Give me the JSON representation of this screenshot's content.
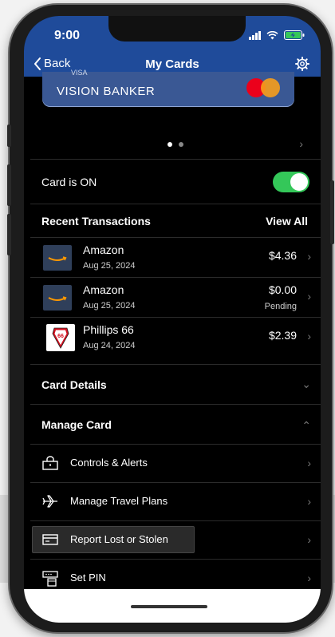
{
  "status_bar": {
    "time": "9:00"
  },
  "nav": {
    "back_label": "Back",
    "title": "My Cards"
  },
  "card": {
    "top_text": "VISA",
    "name": "VISION BANKER",
    "carousel_pages": 2,
    "carousel_active": 1
  },
  "card_status": {
    "label": "Card is ON",
    "enabled": true
  },
  "transactions": {
    "header": "Recent Transactions",
    "view_all": "View All",
    "items": [
      {
        "merchant": "Amazon",
        "date": "Aug 25, 2024",
        "amount": "$4.36",
        "status": "",
        "logo": "amazon-logo"
      },
      {
        "merchant": "Amazon",
        "date": "Aug 25, 2024",
        "amount": "$0.00",
        "status": "Pending",
        "logo": "amazon-logo"
      },
      {
        "merchant": "Phillips 66",
        "date": "Aug 24, 2024",
        "amount": "$2.39",
        "status": "",
        "logo": "phillips66-logo"
      }
    ]
  },
  "sections": {
    "card_details": "Card Details",
    "manage_card": "Manage Card"
  },
  "manage_items": [
    {
      "label": "Controls & Alerts",
      "icon": "lock-icon"
    },
    {
      "label": "Manage Travel Plans",
      "icon": "airplane-icon"
    },
    {
      "label": "Report Lost or Stolen",
      "icon": "card-icon"
    },
    {
      "label": "Set PIN",
      "icon": "keypad-icon"
    }
  ],
  "colors": {
    "header_blue": "#1f4b9a",
    "toggle_green": "#34c759",
    "card_blue": "#3a5894"
  }
}
